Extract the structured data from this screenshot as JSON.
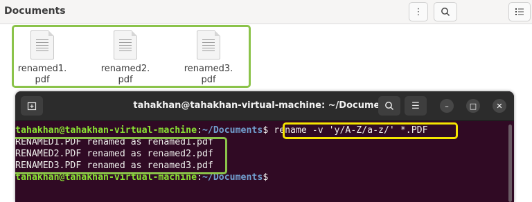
{
  "file_manager": {
    "title": "Documents",
    "buttons": {
      "menu": "⋮",
      "search": "⌕",
      "view": "☰"
    },
    "files": [
      {
        "line1": "renamed1.",
        "line2": "pdf"
      },
      {
        "line1": "renamed2.",
        "line2": "pdf"
      },
      {
        "line1": "renamed3.",
        "line2": "pdf"
      }
    ],
    "highlight_color": "#8bc34a"
  },
  "terminal": {
    "title": "tahakhan@tahakhan-virtual-machine: ~/Documents",
    "new_tab_icon": "⊞",
    "search_icon": "⌕",
    "menu_icon": "☰",
    "window_controls": {
      "minimize": "–",
      "maximize": "□",
      "close": "✕"
    },
    "prompt": {
      "user": "tahakhan@tahakhan-virtual-machine",
      "sep": ":",
      "path": "~/Documents",
      "symbol": "$"
    },
    "command": " rename -v 'y/A-Z/a-z/' *.PDF",
    "output": [
      "RENAMED1.PDF renamed as renamed1.pdf",
      "RENAMED2.PDF renamed as renamed2.pdf",
      "RENAMED3.PDF renamed as renamed3.pdf"
    ],
    "command_highlight_color": "#f5e400",
    "output_highlight_color": "#8bc34a",
    "background_color": "#300a24"
  }
}
